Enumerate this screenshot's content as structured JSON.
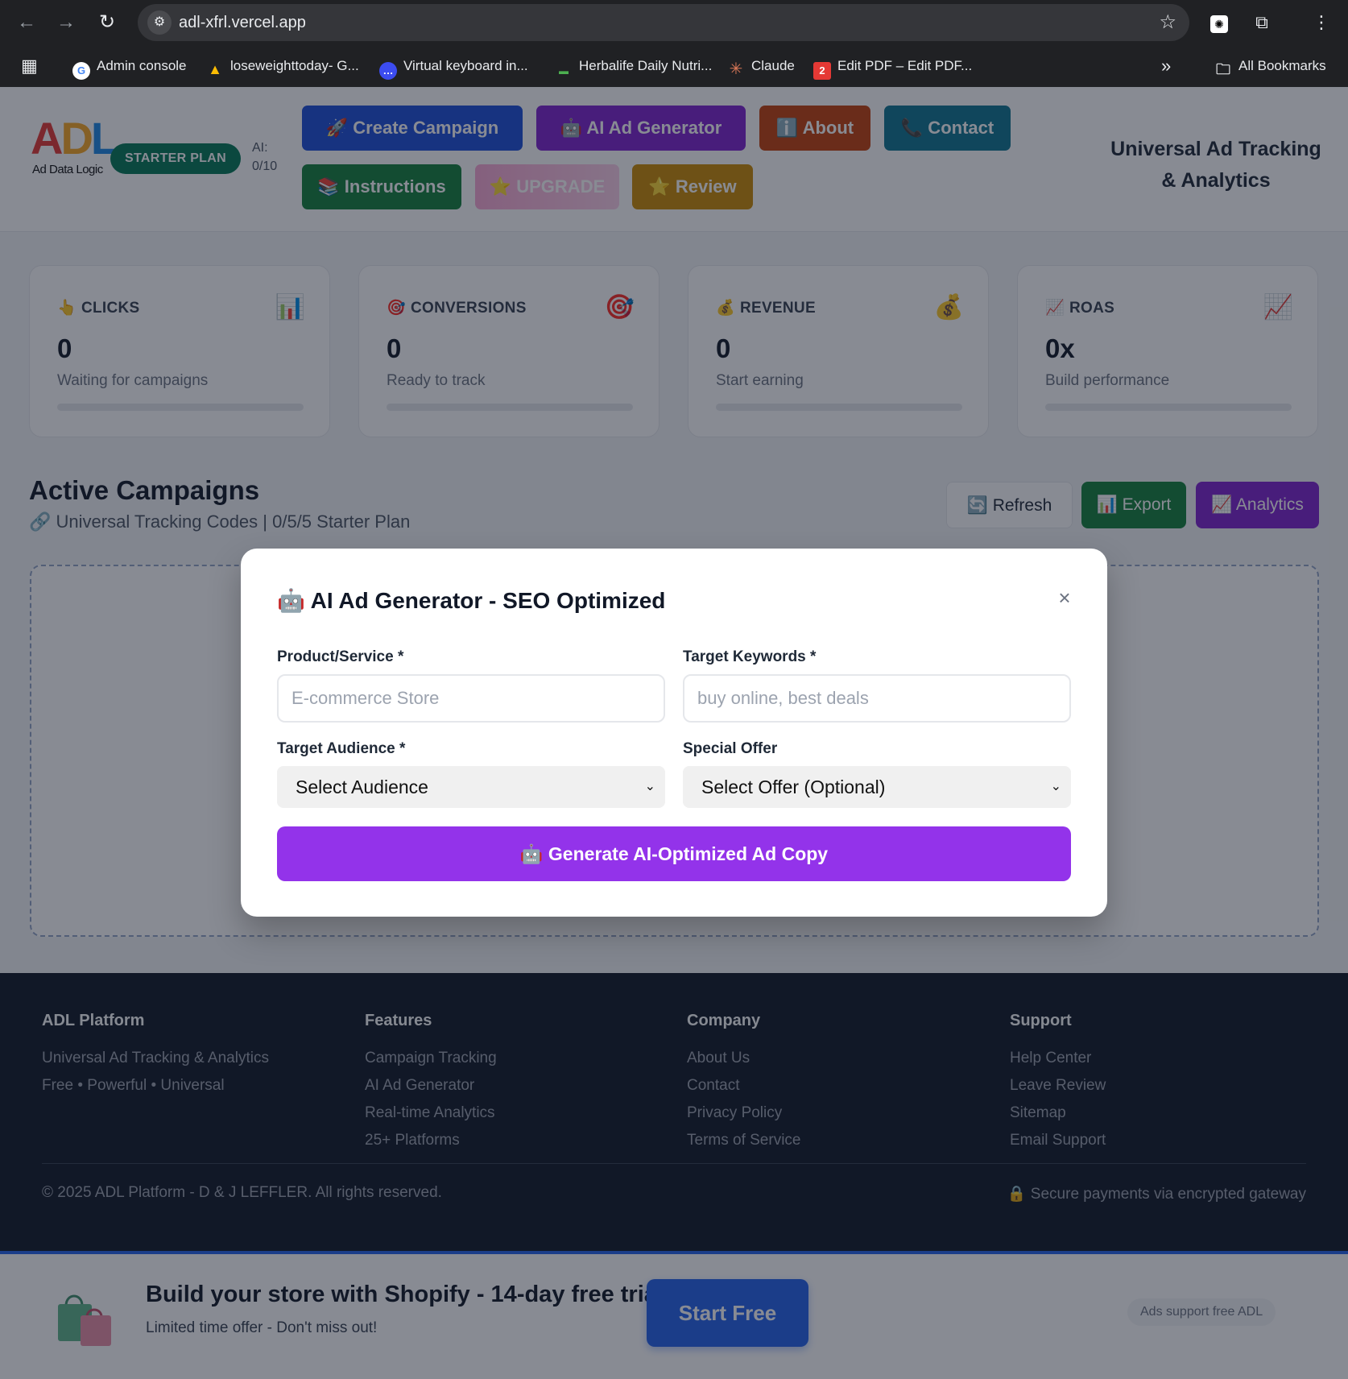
{
  "browser": {
    "url": "adl-xfrl.vercel.app",
    "bookmarks": [
      {
        "label": "Admin console",
        "icon": "google-icon"
      },
      {
        "label": "loseweighttoday- G...",
        "icon": "google-ads-icon"
      },
      {
        "label": "Virtual keyboard in...",
        "icon": "chat-bubble-icon"
      },
      {
        "label": "Herbalife Daily Nutri...",
        "icon": "herbalife-icon"
      },
      {
        "label": "Claude",
        "icon": "claude-icon"
      },
      {
        "label": "Edit PDF – Edit PDF...",
        "icon": "pdf-icon"
      }
    ],
    "all_bookmarks": "All Bookmarks"
  },
  "header": {
    "logo_text": "ADL",
    "logo_sub": "Ad Data Logic",
    "plan_badge": "STARTER PLAN",
    "ai_count": "AI: 0/10",
    "buttons": {
      "create_campaign": "🚀 Create Campaign",
      "ai_ad_generator": "🤖 AI Ad Generator",
      "about": "ℹ️ About",
      "contact": "📞 Contact",
      "instructions": "📚 Instructions",
      "upgrade": "⭐ UPGRADE",
      "review": "⭐ Review"
    },
    "tagline": "Universal Ad Tracking & Analytics",
    "colors": {
      "create": "#1d4ed8",
      "ai": "#7e22ce",
      "about": "#c2410c",
      "contact": "#0e7490",
      "instructions": "#15803d",
      "upgrade": "#f9a8d4",
      "review": "#ca8a04"
    }
  },
  "stats": [
    {
      "emoji": "👆",
      "label": "CLICKS",
      "icon": "📊",
      "value": "0",
      "desc": "Waiting for campaigns"
    },
    {
      "emoji": "🎯",
      "label": "CONVERSIONS",
      "icon": "🎯",
      "value": "0",
      "desc": "Ready to track"
    },
    {
      "emoji": "💰",
      "label": "REVENUE",
      "icon": "💰",
      "value": "0",
      "desc": "Start earning"
    },
    {
      "emoji": "📈",
      "label": "ROAS",
      "icon": "📈",
      "value": "0x",
      "desc": "Build performance"
    }
  ],
  "campaigns": {
    "title": "Active Campaigns",
    "subtitle": "🔗 Universal Tracking Codes | 0/5/5 Starter Plan",
    "refresh": "🔄 Refresh",
    "export": "📊 Export",
    "analytics": "📈 Analytics"
  },
  "footer": {
    "columns": [
      {
        "heading": "ADL Platform",
        "items": [
          "Universal Ad Tracking & Analytics",
          "Free • Powerful • Universal"
        ]
      },
      {
        "heading": "Features",
        "items": [
          "Campaign Tracking",
          "AI Ad Generator",
          "Real-time Analytics",
          "25+ Platforms"
        ]
      },
      {
        "heading": "Company",
        "items": [
          "About Us",
          "Contact",
          "Privacy Policy",
          "Terms of Service"
        ]
      },
      {
        "heading": "Support",
        "items": [
          "Help Center",
          "Leave Review",
          "Sitemap",
          "Email Support"
        ]
      }
    ],
    "copyright": "© 2025 ADL Platform - D & J LEFFLER. All rights reserved.",
    "secure": "🔒 Secure payments via encrypted gateway"
  },
  "shopify": {
    "title": "Build your store with Shopify - 14-day free trial",
    "subtitle": "Limited time offer - Don't miss out!",
    "button": "Start Free",
    "ads_note": "Ads support free ADL"
  },
  "modal": {
    "title": "🤖 AI Ad Generator - SEO Optimized",
    "close": "×",
    "product_label": "Product/Service *",
    "product_placeholder": "E-commerce Store",
    "keywords_label": "Target Keywords *",
    "keywords_placeholder": "buy online, best deals",
    "audience_label": "Target Audience *",
    "audience_value": "Select Audience",
    "offer_label": "Special Offer",
    "offer_value": "Select Offer (Optional)",
    "generate": "🤖 Generate AI-Optimized Ad Copy"
  }
}
